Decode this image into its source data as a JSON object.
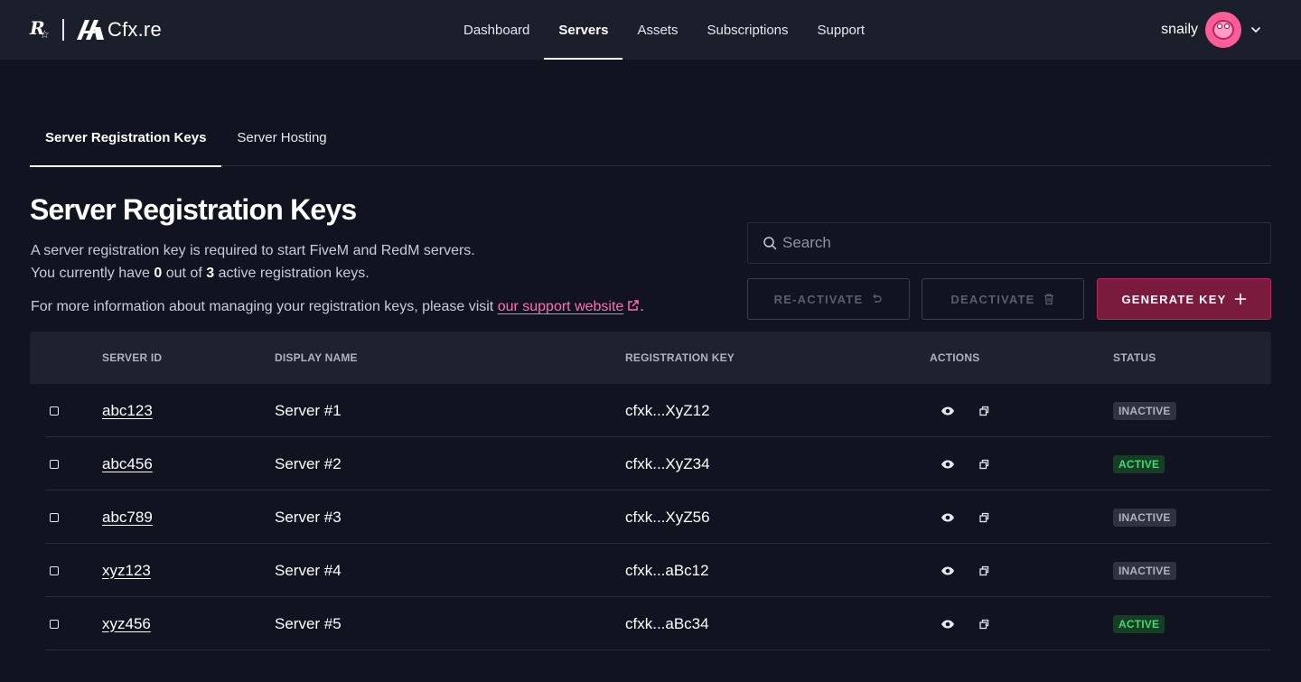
{
  "brand": {
    "logo_text": "Cfx.re"
  },
  "nav": {
    "items": [
      {
        "label": "Dashboard",
        "active": false
      },
      {
        "label": "Servers",
        "active": true
      },
      {
        "label": "Assets",
        "active": false
      },
      {
        "label": "Subscriptions",
        "active": false
      },
      {
        "label": "Support",
        "active": false
      }
    ]
  },
  "user": {
    "name": "snaily",
    "avatar_icon": "avatar-icon"
  },
  "subtabs": [
    {
      "label": "Server Registration Keys",
      "active": true
    },
    {
      "label": "Server Hosting",
      "active": false
    }
  ],
  "page": {
    "title": "Server Registration Keys",
    "desc_line1": "A server registration key is required to start FiveM and RedM servers.",
    "desc_line2_pre": "You currently have ",
    "active_count": "0",
    "desc_line2_mid": " out of ",
    "max_count": "3",
    "desc_line2_post": " active registration keys.",
    "info_pre": "For more information about managing your registration keys, please visit ",
    "info_link": "our support website",
    "info_post": "."
  },
  "search": {
    "placeholder": "Search",
    "value": ""
  },
  "buttons": {
    "reactivate": "RE-ACTIVATE",
    "deactivate": "DEACTIVATE",
    "generate": "GENERATE KEY"
  },
  "table": {
    "columns": [
      "SERVER ID",
      "DISPLAY NAME",
      "REGISTRATION KEY",
      "ACTIONS",
      "STATUS"
    ],
    "rows": [
      {
        "server_id": "abc123",
        "display_name": "Server #1",
        "key": "cfxk...XyZ12",
        "status": "INACTIVE"
      },
      {
        "server_id": "abc456",
        "display_name": "Server #2",
        "key": "cfxk...XyZ34",
        "status": "ACTIVE"
      },
      {
        "server_id": "abc789",
        "display_name": "Server #3",
        "key": "cfxk...XyZ56",
        "status": "INACTIVE"
      },
      {
        "server_id": "xyz123",
        "display_name": "Server #4",
        "key": "cfxk...aBc12",
        "status": "INACTIVE"
      },
      {
        "server_id": "xyz456",
        "display_name": "Server #5",
        "key": "cfxk...aBc34",
        "status": "ACTIVE"
      }
    ]
  },
  "colors": {
    "background": "#111420",
    "topbar": "#1b1e2b",
    "accent": "#7a1a3c",
    "link": "#ff6fae",
    "status_active": "#3fdc70",
    "status_inactive": "#aeb2c0"
  }
}
